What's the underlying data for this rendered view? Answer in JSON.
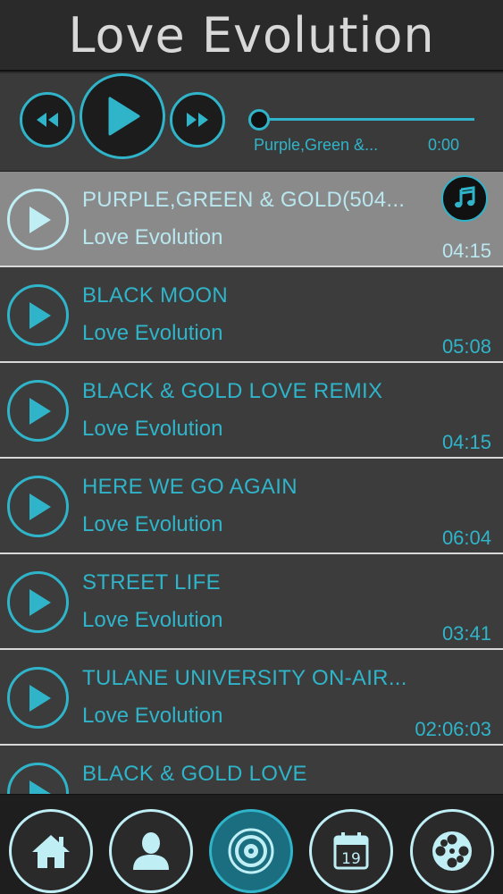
{
  "app": {
    "title": "Love Evolution"
  },
  "player": {
    "now_playing_title": "Purple,Green &...",
    "elapsed": "0:00",
    "progress": 0.0,
    "controls": [
      "rewind-icon",
      "play-icon",
      "fast-forward-icon"
    ]
  },
  "tracks": [
    {
      "title": "PURPLE,GREEN & GOLD(504...",
      "artist": "Love Evolution",
      "duration": "04:15",
      "active": true
    },
    {
      "title": "BLACK MOON",
      "artist": "Love Evolution",
      "duration": "05:08",
      "active": false
    },
    {
      "title": "BLACK & GOLD LOVE REMIX",
      "artist": "Love Evolution",
      "duration": "04:15",
      "active": false
    },
    {
      "title": "HERE WE GO AGAIN",
      "artist": "Love Evolution",
      "duration": "06:04",
      "active": false
    },
    {
      "title": "STREET LIFE",
      "artist": "Love Evolution",
      "duration": "03:41",
      "active": false
    },
    {
      "title": "TULANE UNIVERSITY ON-AIR...",
      "artist": "Love Evolution",
      "duration": "02:06:03",
      "active": false
    },
    {
      "title": "BLACK & GOLD LOVE",
      "artist": "",
      "duration": "",
      "active": false
    }
  ],
  "tabs": [
    {
      "icon": "home-icon",
      "active": false
    },
    {
      "icon": "person-icon",
      "active": false
    },
    {
      "icon": "speaker-icon",
      "active": true
    },
    {
      "icon": "calendar-icon",
      "active": false,
      "calendar_day": "19"
    },
    {
      "icon": "film-reel-icon",
      "active": false
    }
  ],
  "colors": {
    "accent": "#2fb4c9",
    "accent_light": "#bfeef5",
    "background": "#2b2b2b"
  }
}
